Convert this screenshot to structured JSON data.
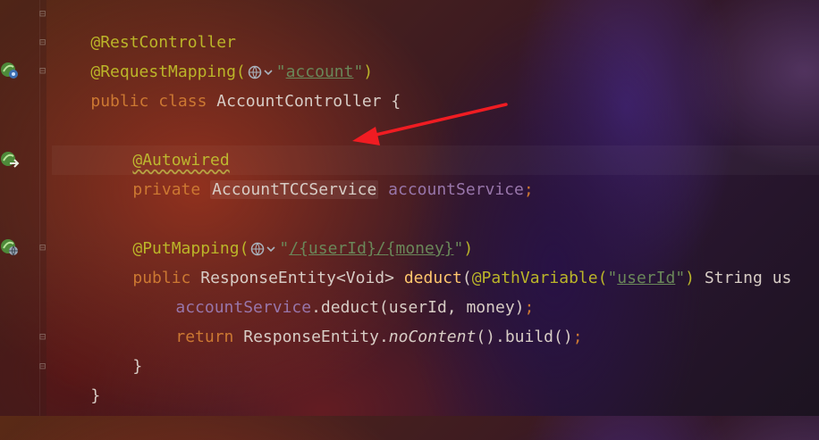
{
  "gutter": {
    "icons": [
      "spring-bean-icon",
      "spring-injection-icon",
      "spring-web-endpoint-icon"
    ]
  },
  "code": {
    "l1": {
      "annotation": "@RestController"
    },
    "l2": {
      "annotation": "@RequestMapping(",
      "path": "account",
      "q1": "\"",
      "q2": "\"",
      "close": ")"
    },
    "l3": {
      "kw1": "public",
      "kw2": "class",
      "name": "AccountController {"
    },
    "l5": {
      "annotation": "@Autowired"
    },
    "l6": {
      "kw": "private",
      "type": "AccountTCCService",
      "field": "accountService",
      "semi": ";"
    },
    "l8": {
      "annotation": "@PutMapping(",
      "q1": "\"",
      "path_start": "/",
      "var1": "{userId}",
      "slash": "/",
      "var2": "{money}",
      "q2": "\"",
      "close": ")"
    },
    "l9": {
      "kw": "public",
      "type": "ResponseEntity<Void>",
      "method": "deduct",
      "open": "(",
      "ann": "@PathVariable",
      "lp": "(",
      "q1": "\"",
      "arg": "userId",
      "q2": "\"",
      "rp": ")",
      "rest": " String us"
    },
    "l10": {
      "field": "accountService",
      "rest": ".deduct(userId, money)",
      "semi": ";"
    },
    "l11": {
      "kw": "return",
      "type": " ResponseEntity.",
      "method": "noContent",
      "rest": "().build()",
      "semi": ";"
    },
    "l12": {
      "text": "}"
    },
    "l13": {
      "text": "}"
    }
  }
}
